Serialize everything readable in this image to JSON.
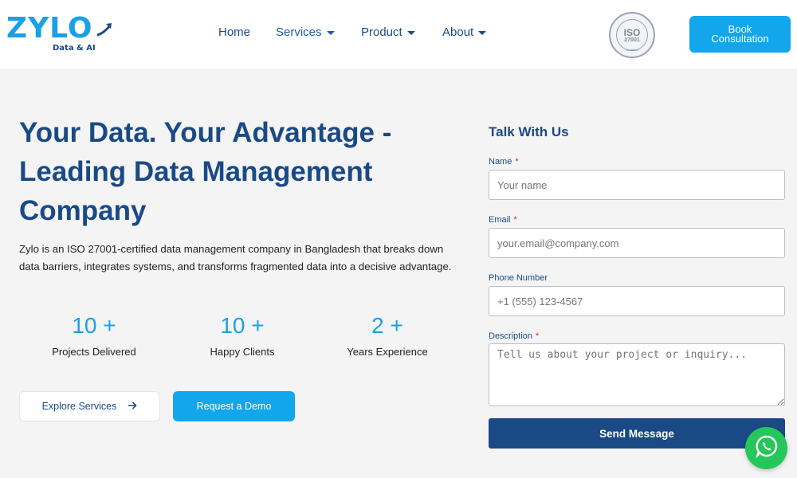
{
  "header": {
    "logo_text": "ZYLO",
    "logo_subtitle": "Data & AI",
    "nav": [
      {
        "label": "Home",
        "has_dropdown": false
      },
      {
        "label": "Services",
        "has_dropdown": true
      },
      {
        "label": "Product",
        "has_dropdown": true
      },
      {
        "label": "About",
        "has_dropdown": true
      }
    ],
    "iso_badge": {
      "main": "ISO",
      "number": "27001",
      "status": "Certified"
    },
    "book_button": {
      "line1": "Book",
      "line2": "Consultation"
    }
  },
  "hero": {
    "title_line1": "Your Data. Your Advantage -",
    "title_line2": "Leading Data Management",
    "title_line3": "Company",
    "description": "Zylo is an ISO 27001-certified data management company in Bangladesh that breaks down data barriers, integrates systems, and transforms fragmented data into a decisive advantage.",
    "stats": [
      {
        "value": "10 +",
        "label": "Projects Delivered"
      },
      {
        "value": "10 +",
        "label": "Happy Clients"
      },
      {
        "value": "2 +",
        "label": "Years Experience"
      }
    ],
    "explore_label": "Explore Services",
    "demo_label": "Request a Demo"
  },
  "form": {
    "title": "Talk With Us",
    "fields": [
      {
        "label": "Name",
        "required": true,
        "placeholder": "Your name"
      },
      {
        "label": "Email",
        "required": true,
        "placeholder": "your.email@company.com"
      },
      {
        "label": "Phone Number",
        "required": false,
        "placeholder": "+1 (555) 123-4567"
      },
      {
        "label": "Description",
        "required": true,
        "placeholder": "Tell us about your project or inquiry..."
      }
    ],
    "required_marker": "*",
    "submit_label": "Send Message"
  },
  "colors": {
    "primary_navy": "#1a4a86",
    "accent_blue": "#12a6ec",
    "whatsapp_green": "#25c65a",
    "required_red": "#e02424"
  },
  "icons": {
    "explore": "arrow-right-icon",
    "chat": "whatsapp-icon",
    "dropdown": "caret-down-icon"
  }
}
